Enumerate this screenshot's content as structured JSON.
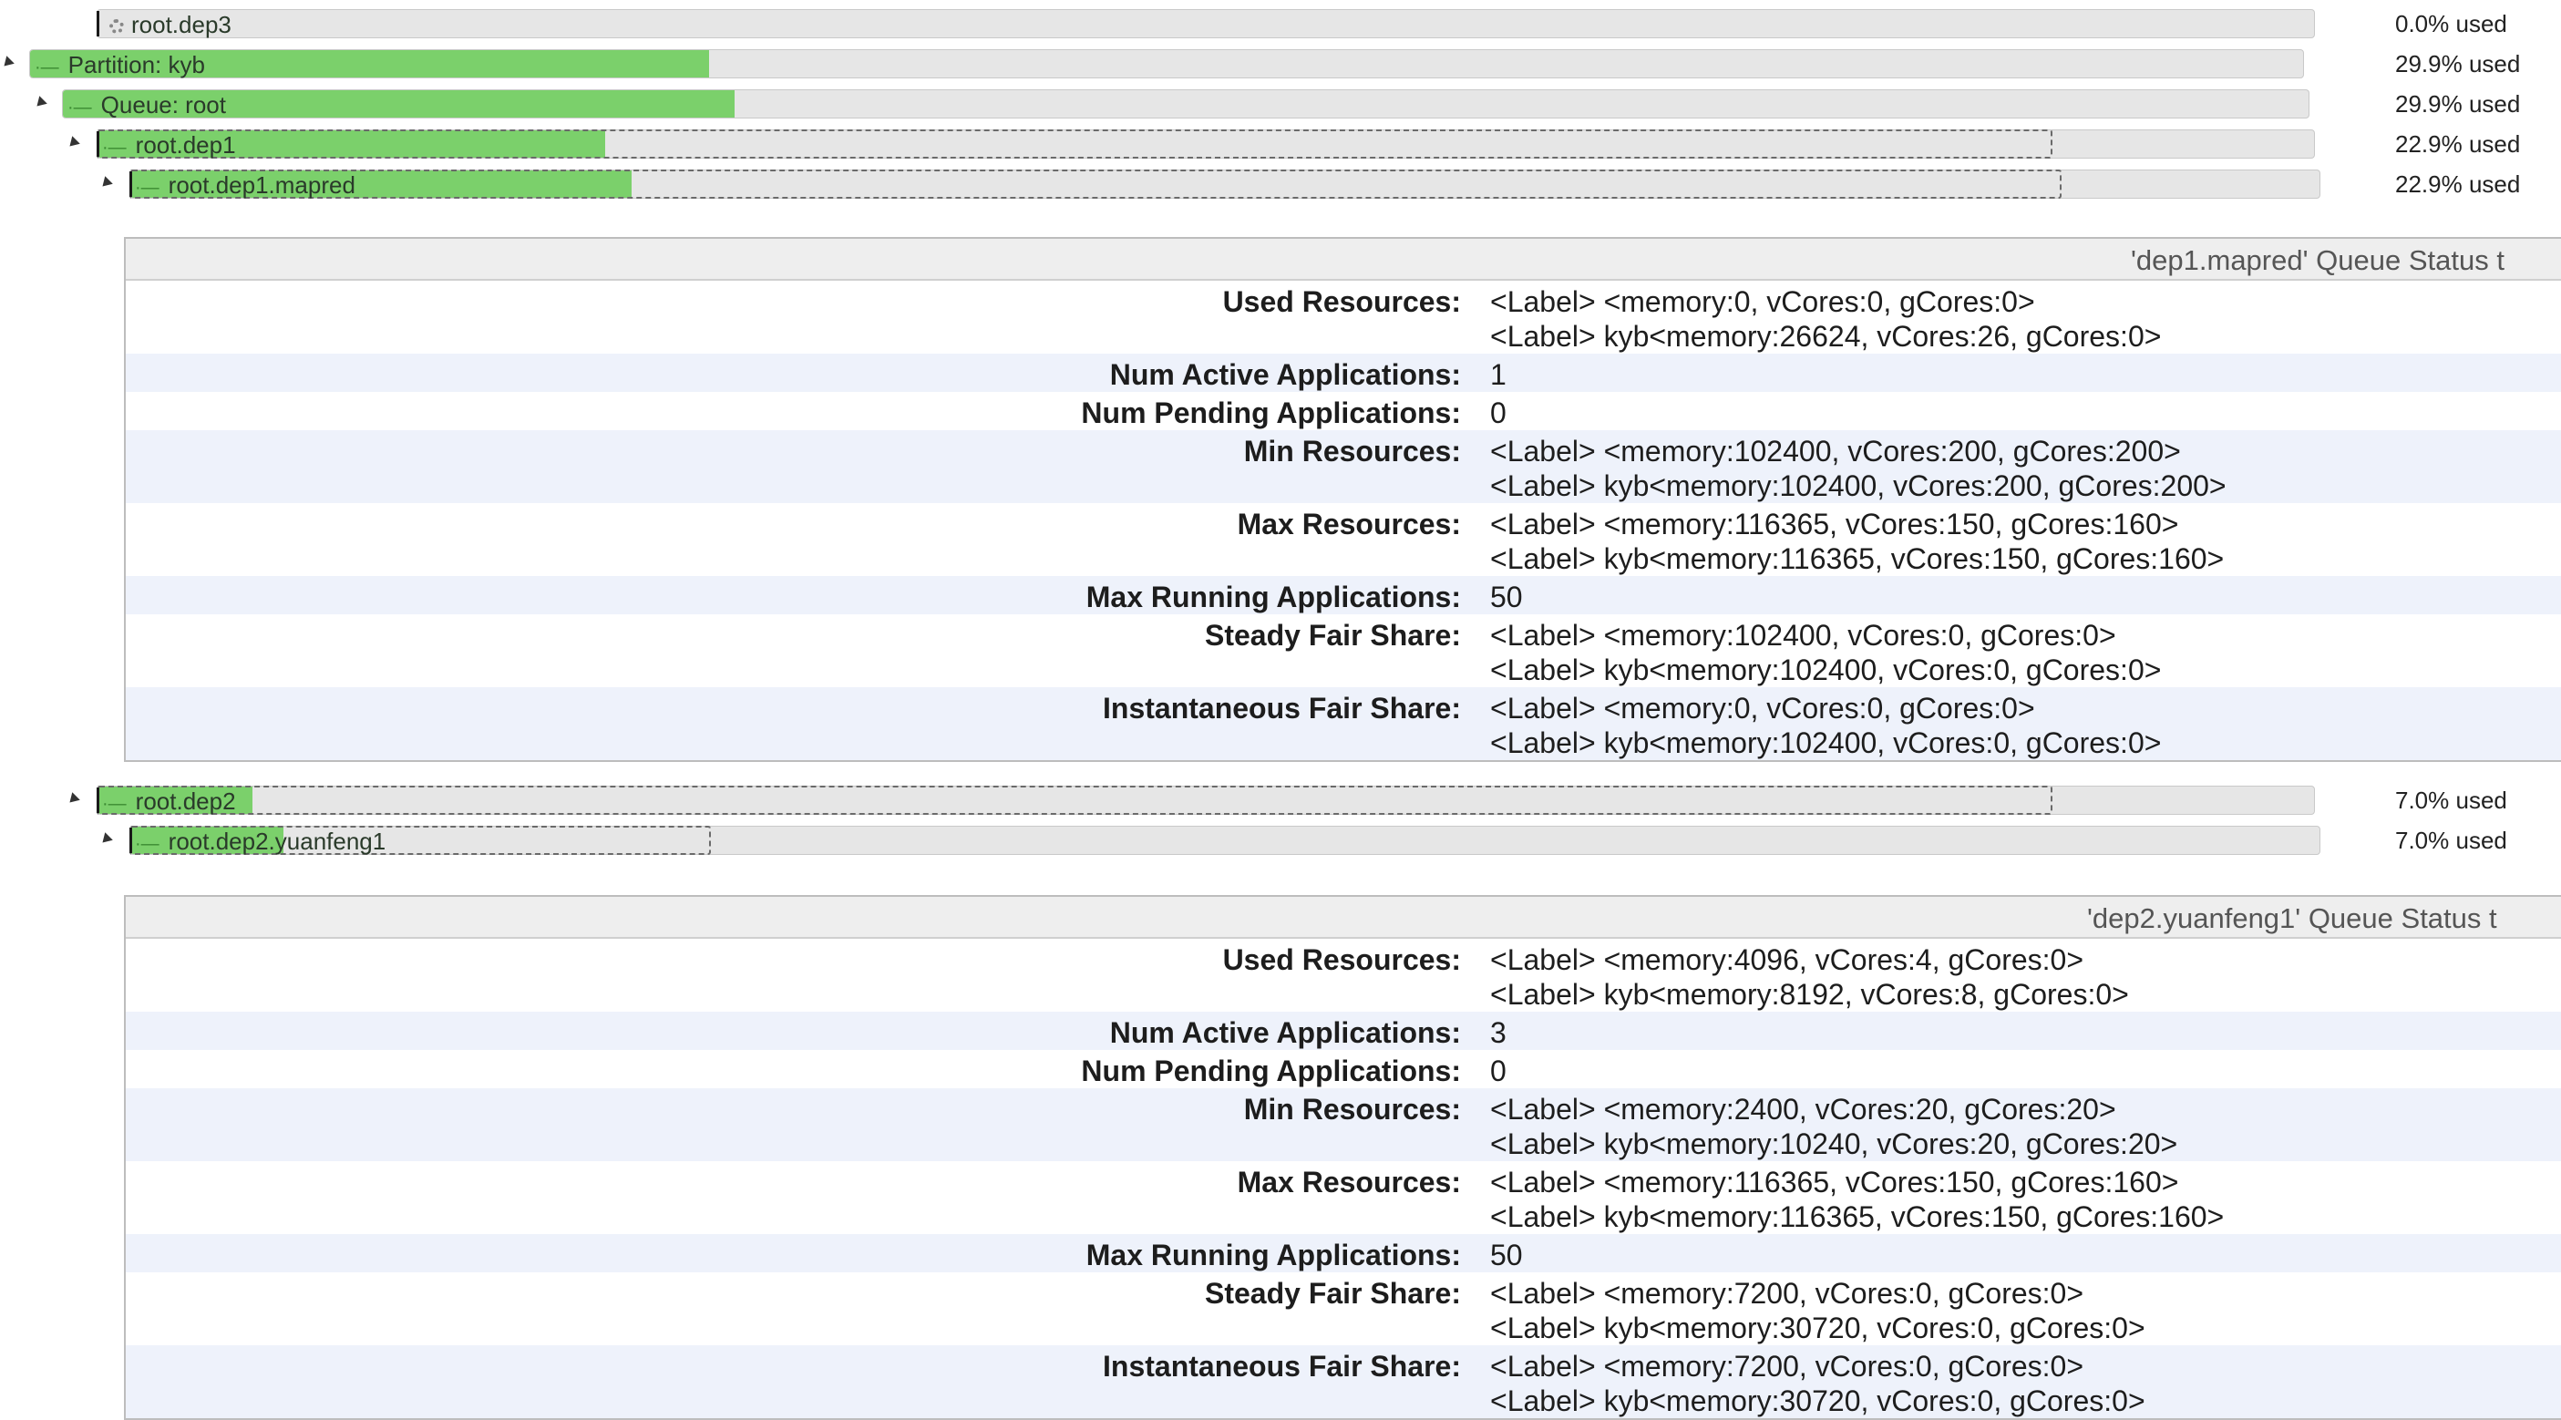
{
  "queues_top": [
    {
      "name": "root.dep3",
      "used": "0.0% used",
      "fill_fraction": 0.0,
      "kind": "leaf-gear"
    },
    {
      "name": "Partition: kyb",
      "used": "29.9% used",
      "fill_fraction": 0.299
    },
    {
      "name": "Queue: root",
      "used": "29.9% used",
      "fill_fraction": 0.299
    },
    {
      "name": "root.dep1",
      "used": "22.9% used",
      "fill_fraction": 0.229
    },
    {
      "name": "root.dep1.mapred",
      "used": "22.9% used",
      "fill_fraction": 0.229
    }
  ],
  "panel1": {
    "title": "'dep1.mapred' Queue Status t",
    "rows": [
      {
        "key": "Used Resources:",
        "values": [
          "<Label> <memory:0, vCores:0, gCores:0>",
          "<Label> kyb<memory:26624, vCores:26, gCores:0>"
        ]
      },
      {
        "key": "Num Active Applications:",
        "values": [
          "1"
        ]
      },
      {
        "key": "Num Pending Applications:",
        "values": [
          "0"
        ]
      },
      {
        "key": "Min Resources:",
        "values": [
          "<Label> <memory:102400, vCores:200, gCores:200>",
          "<Label> kyb<memory:102400, vCores:200, gCores:200>"
        ]
      },
      {
        "key": "Max Resources:",
        "values": [
          "<Label> <memory:116365, vCores:150, gCores:160>",
          "<Label> kyb<memory:116365, vCores:150, gCores:160>"
        ]
      },
      {
        "key": "Max Running Applications:",
        "values": [
          "50"
        ]
      },
      {
        "key": "Steady Fair Share:",
        "values": [
          "<Label> <memory:102400, vCores:0, gCores:0>",
          "<Label> kyb<memory:102400, vCores:0, gCores:0>"
        ]
      },
      {
        "key": "Instantaneous Fair Share:",
        "values": [
          "<Label> <memory:0, vCores:0, gCores:0>",
          "<Label> kyb<memory:102400, vCores:0, gCores:0>"
        ]
      }
    ]
  },
  "queues_mid": [
    {
      "name": "root.dep2",
      "used": "7.0% used",
      "fill_fraction": 0.07
    },
    {
      "name_a": "root.dep2",
      "name_b": ".yuanfeng1",
      "used": "7.0% used",
      "fill_fraction": 0.07
    }
  ],
  "panel2": {
    "title": "'dep2.yuanfeng1' Queue Status t",
    "rows": [
      {
        "key": "Used Resources:",
        "values": [
          "<Label> <memory:4096, vCores:4, gCores:0>",
          "<Label> kyb<memory:8192, vCores:8, gCores:0>"
        ]
      },
      {
        "key": "Num Active Applications:",
        "values": [
          "3"
        ]
      },
      {
        "key": "Num Pending Applications:",
        "values": [
          "0"
        ]
      },
      {
        "key": "Min Resources:",
        "values": [
          "<Label> <memory:2400, vCores:20, gCores:20>",
          "<Label> kyb<memory:10240, vCores:20, gCores:20>"
        ]
      },
      {
        "key": "Max Resources:",
        "values": [
          "<Label> <memory:116365, vCores:150, gCores:160>",
          "<Label> kyb<memory:116365, vCores:150, gCores:160>"
        ]
      },
      {
        "key": "Max Running Applications:",
        "values": [
          "50"
        ]
      },
      {
        "key": "Steady Fair Share:",
        "values": [
          "<Label> <memory:7200, vCores:0, gCores:0>",
          "<Label> kyb<memory:30720, vCores:0, gCores:0>"
        ]
      },
      {
        "key": "Instantaneous Fair Share:",
        "values": [
          "<Label> <memory:7200, vCores:0, gCores:0>",
          "<Label> kyb<memory:30720, vCores:0, gCores:0>"
        ]
      }
    ]
  },
  "colors": {
    "fill": "#7bd06b",
    "track": "#e6e6e6",
    "alt_row": "#eef2fb"
  }
}
